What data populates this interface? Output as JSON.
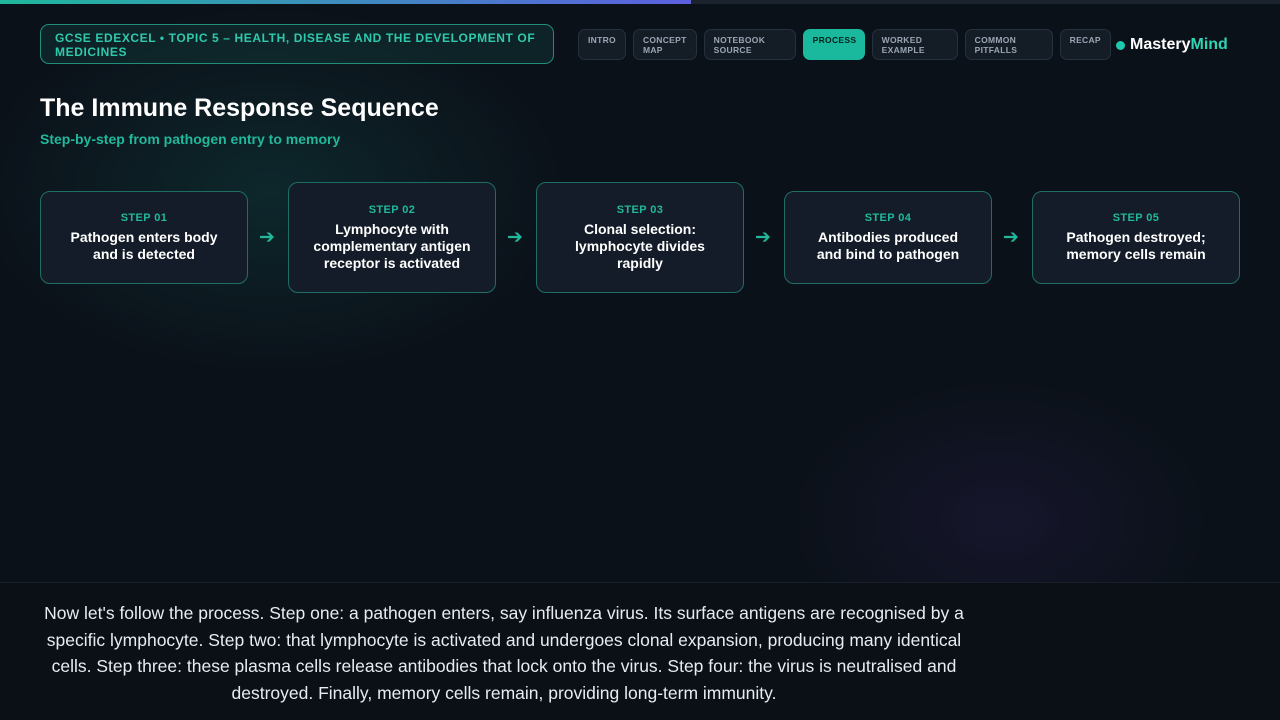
{
  "progress": {
    "fraction": 0.54
  },
  "topic": {
    "label": "GCSE EDEXCEL • TOPIC 5 – HEALTH, DISEASE AND THE DEVELOPMENT OF MEDICINES"
  },
  "nav": {
    "tabs": [
      {
        "line1": "INTRO",
        "line2": "",
        "active": false
      },
      {
        "line1": "CONCEPT",
        "line2": "MAP",
        "active": false
      },
      {
        "line1": "NOTEBOOK",
        "line2": "SOURCE",
        "active": false
      },
      {
        "line1": "PROCESS",
        "line2": "",
        "active": true
      },
      {
        "line1": "WORKED",
        "line2": "EXAMPLE",
        "active": false
      },
      {
        "line1": "COMMON",
        "line2": "PITFALLS",
        "active": false
      },
      {
        "line1": "RECAP",
        "line2": "",
        "active": false
      }
    ]
  },
  "brand": {
    "part1": "Mastery",
    "part2": "Mind"
  },
  "slide": {
    "title": "The Immune Response Sequence",
    "subtitle": "Step-by-step from pathogen entry to memory"
  },
  "steps": [
    {
      "label": "STEP 01",
      "text": "Pathogen enters body and is detected"
    },
    {
      "label": "STEP 02",
      "text": "Lymphocyte with complementary antigen receptor is activated"
    },
    {
      "label": "STEP 03",
      "text": "Clonal selection: lymphocyte divides rapidly"
    },
    {
      "label": "STEP 04",
      "text": "Antibodies produced and bind to pathogen"
    },
    {
      "label": "STEP 05",
      "text": "Pathogen destroyed; memory cells remain"
    }
  ],
  "arrow_glyph": "➔",
  "caption": {
    "text": "Now let's follow the process. Step one: a pathogen enters, say influenza virus. Its surface antigens are recognised by a specific lymphocyte. Step two: that lymphocyte is activated and undergoes clonal expansion, producing many identical cells. Step three: these plasma cells release antibodies that lock onto the virus. Step four: the virus is neutralised and destroyed. Finally, memory cells remain, providing long-term immunity."
  },
  "colors": {
    "accent": "#1ab89d",
    "background": "#0b1119",
    "card": "#131c28",
    "card_border": "#1f6e66"
  }
}
